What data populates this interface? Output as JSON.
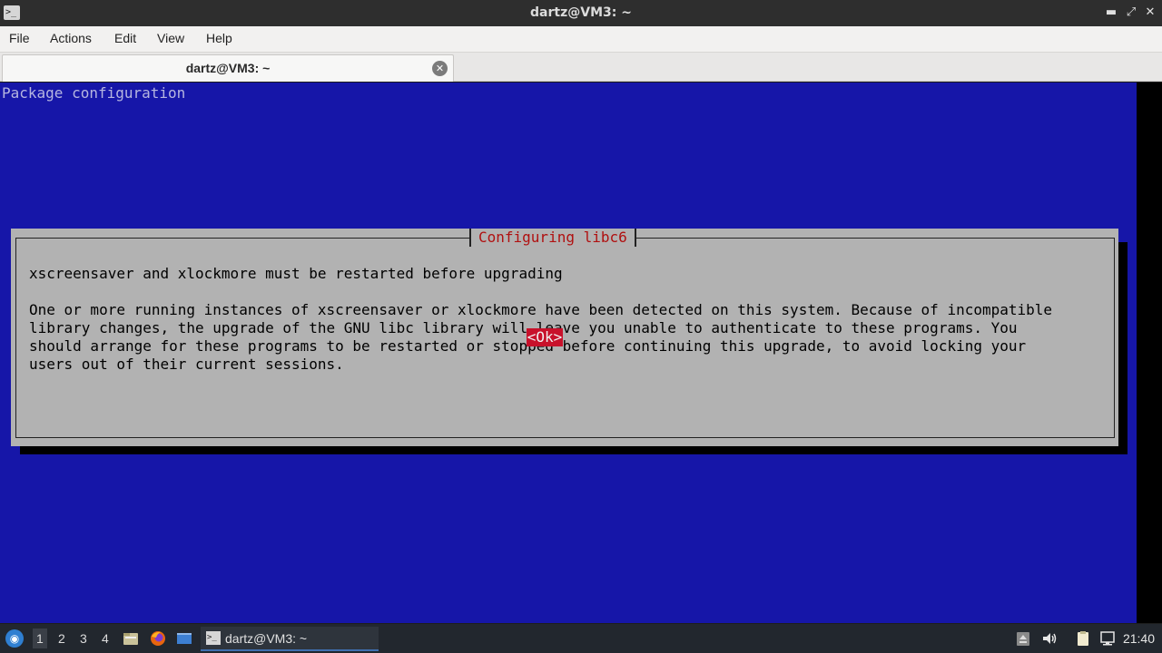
{
  "window": {
    "title": "dartz@VM3: ~",
    "minimize_glyph": "▬",
    "maximize_glyph": "⤢",
    "close_glyph": "✕"
  },
  "menu": [
    "File",
    "Actions",
    "Edit",
    "View",
    "Help"
  ],
  "tab": {
    "label": "dartz@VM3: ~",
    "close_glyph": "✕"
  },
  "terminal": {
    "heading": "Package configuration",
    "dialog": {
      "title": "Configuring libc6",
      "headline": "xscreensaver and xlockmore must be restarted before upgrading",
      "body": [
        "One or more running instances of xscreensaver or xlockmore have been detected on this system. Because of incompatible",
        "library changes, the upgrade of the GNU libc library will leave you unable to authenticate to these programs. You",
        "should arrange for these programs to be restarted or stopped before continuing this upgrade, to avoid locking your",
        "users out of their current sessions."
      ],
      "ok_label": "<Ok>"
    }
  },
  "taskbar": {
    "workspaces": [
      "1",
      "2",
      "3",
      "4"
    ],
    "active_workspace": "1",
    "task_label": "dartz@VM3: ~",
    "clock": "21:40",
    "icons": [
      "start-menu-icon",
      "file-manager-icon",
      "firefox-icon",
      "show-desktop-icon",
      "terminal-icon",
      "removable-drive-icon",
      "volume-icon",
      "clipboard-icon",
      "network-icon"
    ]
  },
  "colors": {
    "terminal_bg": "#1616a8",
    "dialog_bg": "#b2b2b2",
    "dialog_title": "#b01010",
    "ok_button_bg": "#c8112b"
  }
}
